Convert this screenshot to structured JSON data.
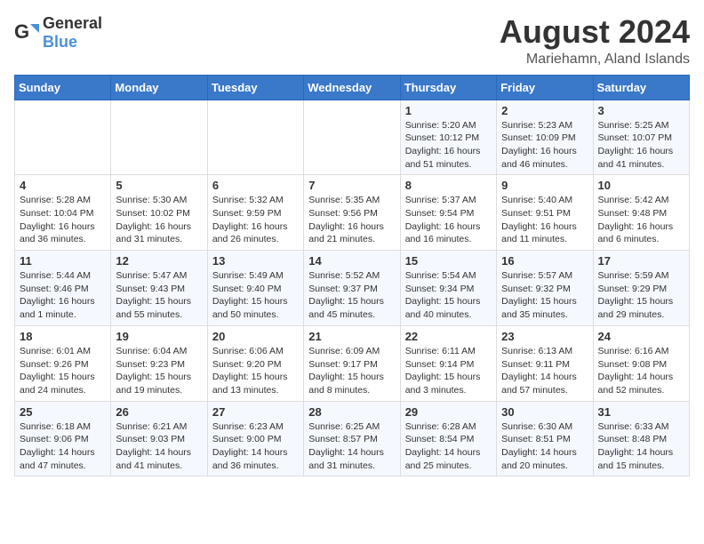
{
  "logo": {
    "text_general": "General",
    "text_blue": "Blue"
  },
  "title": "August 2024",
  "subtitle": "Mariehamn, Aland Islands",
  "weekdays": [
    "Sunday",
    "Monday",
    "Tuesday",
    "Wednesday",
    "Thursday",
    "Friday",
    "Saturday"
  ],
  "weeks": [
    [
      {
        "day": "",
        "info": ""
      },
      {
        "day": "",
        "info": ""
      },
      {
        "day": "",
        "info": ""
      },
      {
        "day": "",
        "info": ""
      },
      {
        "day": "1",
        "info": "Sunrise: 5:20 AM\nSunset: 10:12 PM\nDaylight: 16 hours\nand 51 minutes."
      },
      {
        "day": "2",
        "info": "Sunrise: 5:23 AM\nSunset: 10:09 PM\nDaylight: 16 hours\nand 46 minutes."
      },
      {
        "day": "3",
        "info": "Sunrise: 5:25 AM\nSunset: 10:07 PM\nDaylight: 16 hours\nand 41 minutes."
      }
    ],
    [
      {
        "day": "4",
        "info": "Sunrise: 5:28 AM\nSunset: 10:04 PM\nDaylight: 16 hours\nand 36 minutes."
      },
      {
        "day": "5",
        "info": "Sunrise: 5:30 AM\nSunset: 10:02 PM\nDaylight: 16 hours\nand 31 minutes."
      },
      {
        "day": "6",
        "info": "Sunrise: 5:32 AM\nSunset: 9:59 PM\nDaylight: 16 hours\nand 26 minutes."
      },
      {
        "day": "7",
        "info": "Sunrise: 5:35 AM\nSunset: 9:56 PM\nDaylight: 16 hours\nand 21 minutes."
      },
      {
        "day": "8",
        "info": "Sunrise: 5:37 AM\nSunset: 9:54 PM\nDaylight: 16 hours\nand 16 minutes."
      },
      {
        "day": "9",
        "info": "Sunrise: 5:40 AM\nSunset: 9:51 PM\nDaylight: 16 hours\nand 11 minutes."
      },
      {
        "day": "10",
        "info": "Sunrise: 5:42 AM\nSunset: 9:48 PM\nDaylight: 16 hours\nand 6 minutes."
      }
    ],
    [
      {
        "day": "11",
        "info": "Sunrise: 5:44 AM\nSunset: 9:46 PM\nDaylight: 16 hours\nand 1 minute."
      },
      {
        "day": "12",
        "info": "Sunrise: 5:47 AM\nSunset: 9:43 PM\nDaylight: 15 hours\nand 55 minutes."
      },
      {
        "day": "13",
        "info": "Sunrise: 5:49 AM\nSunset: 9:40 PM\nDaylight: 15 hours\nand 50 minutes."
      },
      {
        "day": "14",
        "info": "Sunrise: 5:52 AM\nSunset: 9:37 PM\nDaylight: 15 hours\nand 45 minutes."
      },
      {
        "day": "15",
        "info": "Sunrise: 5:54 AM\nSunset: 9:34 PM\nDaylight: 15 hours\nand 40 minutes."
      },
      {
        "day": "16",
        "info": "Sunrise: 5:57 AM\nSunset: 9:32 PM\nDaylight: 15 hours\nand 35 minutes."
      },
      {
        "day": "17",
        "info": "Sunrise: 5:59 AM\nSunset: 9:29 PM\nDaylight: 15 hours\nand 29 minutes."
      }
    ],
    [
      {
        "day": "18",
        "info": "Sunrise: 6:01 AM\nSunset: 9:26 PM\nDaylight: 15 hours\nand 24 minutes."
      },
      {
        "day": "19",
        "info": "Sunrise: 6:04 AM\nSunset: 9:23 PM\nDaylight: 15 hours\nand 19 minutes."
      },
      {
        "day": "20",
        "info": "Sunrise: 6:06 AM\nSunset: 9:20 PM\nDaylight: 15 hours\nand 13 minutes."
      },
      {
        "day": "21",
        "info": "Sunrise: 6:09 AM\nSunset: 9:17 PM\nDaylight: 15 hours\nand 8 minutes."
      },
      {
        "day": "22",
        "info": "Sunrise: 6:11 AM\nSunset: 9:14 PM\nDaylight: 15 hours\nand 3 minutes."
      },
      {
        "day": "23",
        "info": "Sunrise: 6:13 AM\nSunset: 9:11 PM\nDaylight: 14 hours\nand 57 minutes."
      },
      {
        "day": "24",
        "info": "Sunrise: 6:16 AM\nSunset: 9:08 PM\nDaylight: 14 hours\nand 52 minutes."
      }
    ],
    [
      {
        "day": "25",
        "info": "Sunrise: 6:18 AM\nSunset: 9:06 PM\nDaylight: 14 hours\nand 47 minutes."
      },
      {
        "day": "26",
        "info": "Sunrise: 6:21 AM\nSunset: 9:03 PM\nDaylight: 14 hours\nand 41 minutes."
      },
      {
        "day": "27",
        "info": "Sunrise: 6:23 AM\nSunset: 9:00 PM\nDaylight: 14 hours\nand 36 minutes."
      },
      {
        "day": "28",
        "info": "Sunrise: 6:25 AM\nSunset: 8:57 PM\nDaylight: 14 hours\nand 31 minutes."
      },
      {
        "day": "29",
        "info": "Sunrise: 6:28 AM\nSunset: 8:54 PM\nDaylight: 14 hours\nand 25 minutes."
      },
      {
        "day": "30",
        "info": "Sunrise: 6:30 AM\nSunset: 8:51 PM\nDaylight: 14 hours\nand 20 minutes."
      },
      {
        "day": "31",
        "info": "Sunrise: 6:33 AM\nSunset: 8:48 PM\nDaylight: 14 hours\nand 15 minutes."
      }
    ]
  ]
}
